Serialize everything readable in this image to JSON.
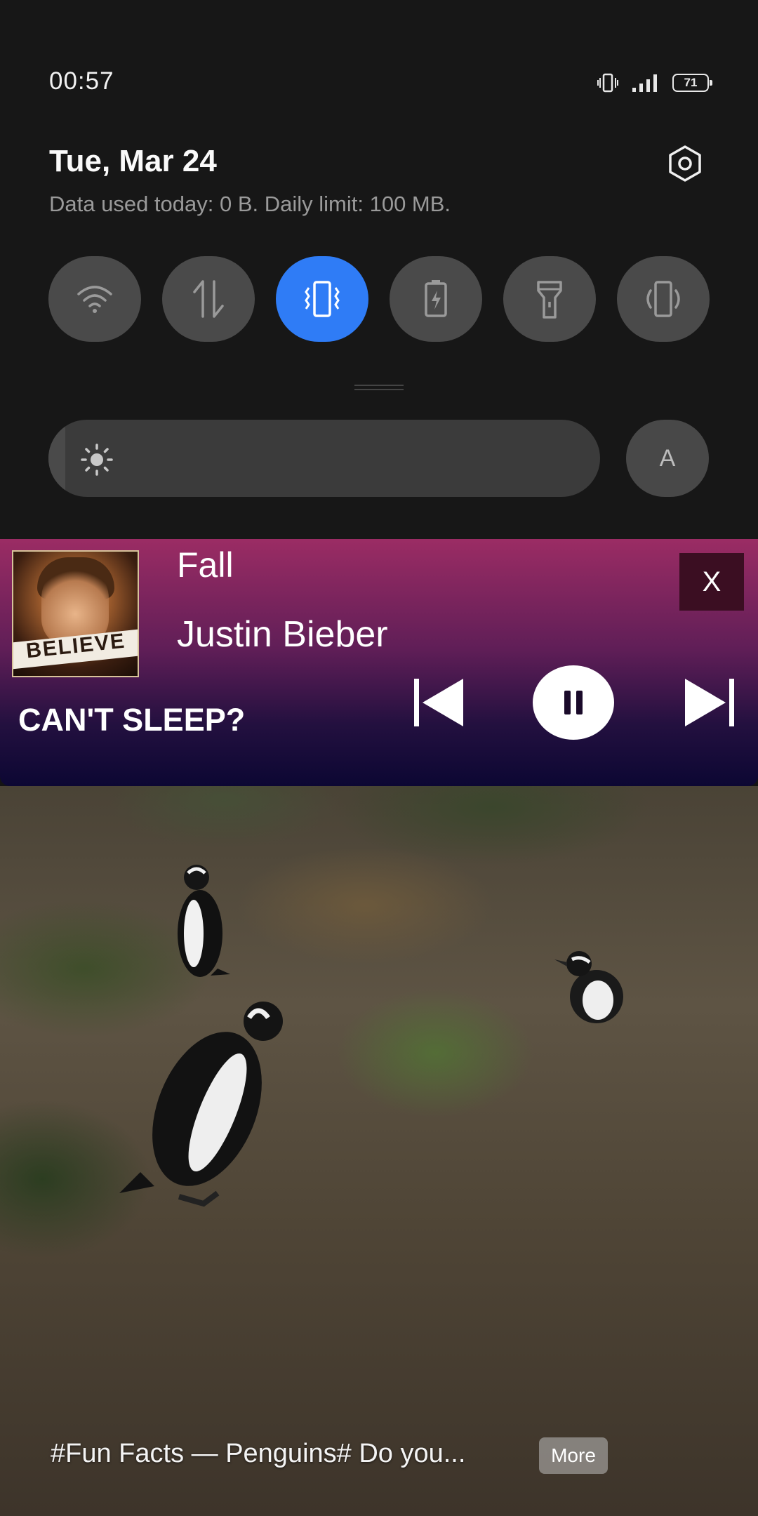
{
  "status_bar": {
    "time": "00:57",
    "battery_level": "71",
    "icons": [
      "vibrate-icon",
      "signal-icon",
      "battery-icon"
    ]
  },
  "quick_settings": {
    "date": "Tue, Mar 24",
    "data_usage": "Data used today: 0 B. Daily limit: 100 MB.",
    "tiles": [
      {
        "icon": "wifi-icon",
        "active": false
      },
      {
        "icon": "mobile-data-icon",
        "active": false
      },
      {
        "icon": "vibrate-icon",
        "active": true
      },
      {
        "icon": "battery-saver-icon",
        "active": false
      },
      {
        "icon": "flashlight-icon",
        "active": false
      },
      {
        "icon": "auto-rotate-icon",
        "active": false
      }
    ],
    "auto_brightness_label": "A",
    "brightness_level": 0.03,
    "accent_color": "#2f7cf6"
  },
  "media_player": {
    "album_art_text": "BELIEVE",
    "title": "Fall",
    "artist": "Justin Bieber",
    "close_label": "X",
    "promo_text": "CAN'T SLEEP?",
    "gradient_top": "#9b2c64",
    "gradient_bottom": "#0c0733"
  },
  "lockscreen_story": {
    "text": "#Fun Facts — Penguins#   Do you...",
    "more_label": "More"
  }
}
